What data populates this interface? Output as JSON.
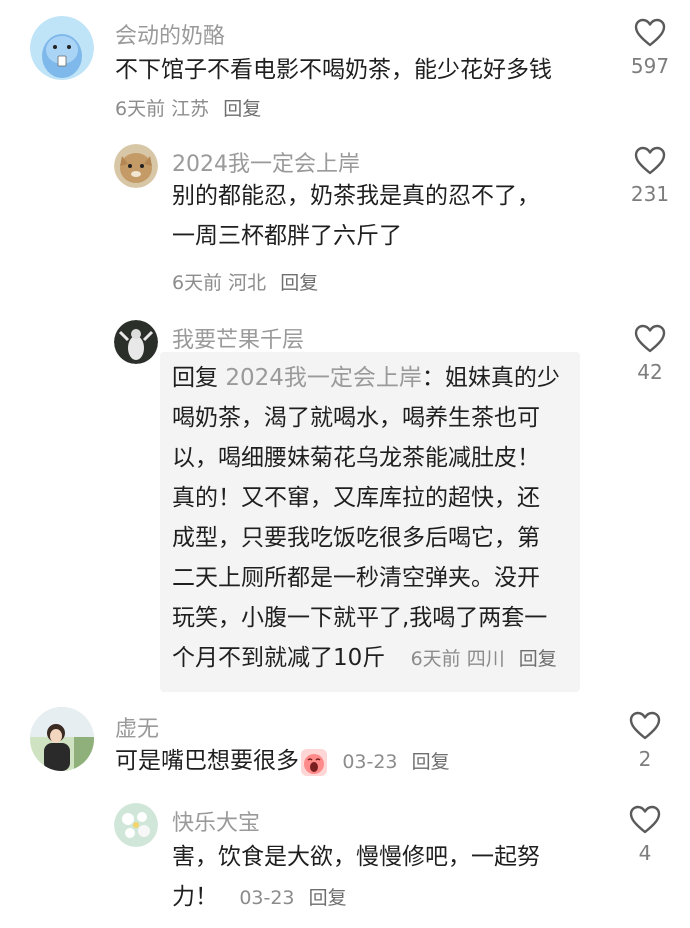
{
  "comments": [
    {
      "author": "会动的奶酪",
      "text": "不下馆子不看电影不喝奶茶，能少花好多钱",
      "time": "6天前",
      "location": "江苏",
      "reply_label": "回复",
      "likes": "597"
    },
    {
      "author": "2024我一定会上岸",
      "lines": [
        "别的都能忍，奶茶我是真的忍不了，",
        "一周三杯都胖了六斤了"
      ],
      "time": "6天前",
      "location": "河北",
      "reply_label": "回复",
      "likes": "231"
    },
    {
      "author": "我要芒果千层",
      "reply_prefix": "回复",
      "reply_to": "2024我一定会上岸",
      "lines": [
        "：姐妹真的少",
        "喝奶茶，渴了就喝水，喝养生茶也可",
        "以，喝细腰妹菊花乌龙茶能减肚皮！",
        "真的！又不窜，又库库拉的超快，还",
        "成型，只要我吃饭吃很多后喝它，第",
        "二天上厕所都是一秒清空弹夹。没开",
        "玩笑，小腹一下就平了,我喝了两套一",
        "个月不到就减了10斤"
      ],
      "time": "6天前",
      "location": "四川",
      "reply_label": "回复",
      "likes": "42"
    },
    {
      "author": "虚无",
      "text": "可是嘴巴想要很多",
      "emoji": "crying-face-emoji",
      "time": "03-23",
      "reply_label": "回复",
      "likes": "2"
    },
    {
      "author": "快乐大宝",
      "lines": [
        "害，饮食是大欲，慢慢修吧，一起努",
        "力！"
      ],
      "time": "03-23",
      "reply_label": "回复",
      "likes": "4"
    }
  ],
  "icons": {
    "like": "heart-outline-icon"
  },
  "colors": {
    "muted": "#9a9a9a",
    "text": "#1f1f1f",
    "highlight": "#f4f4f4"
  }
}
